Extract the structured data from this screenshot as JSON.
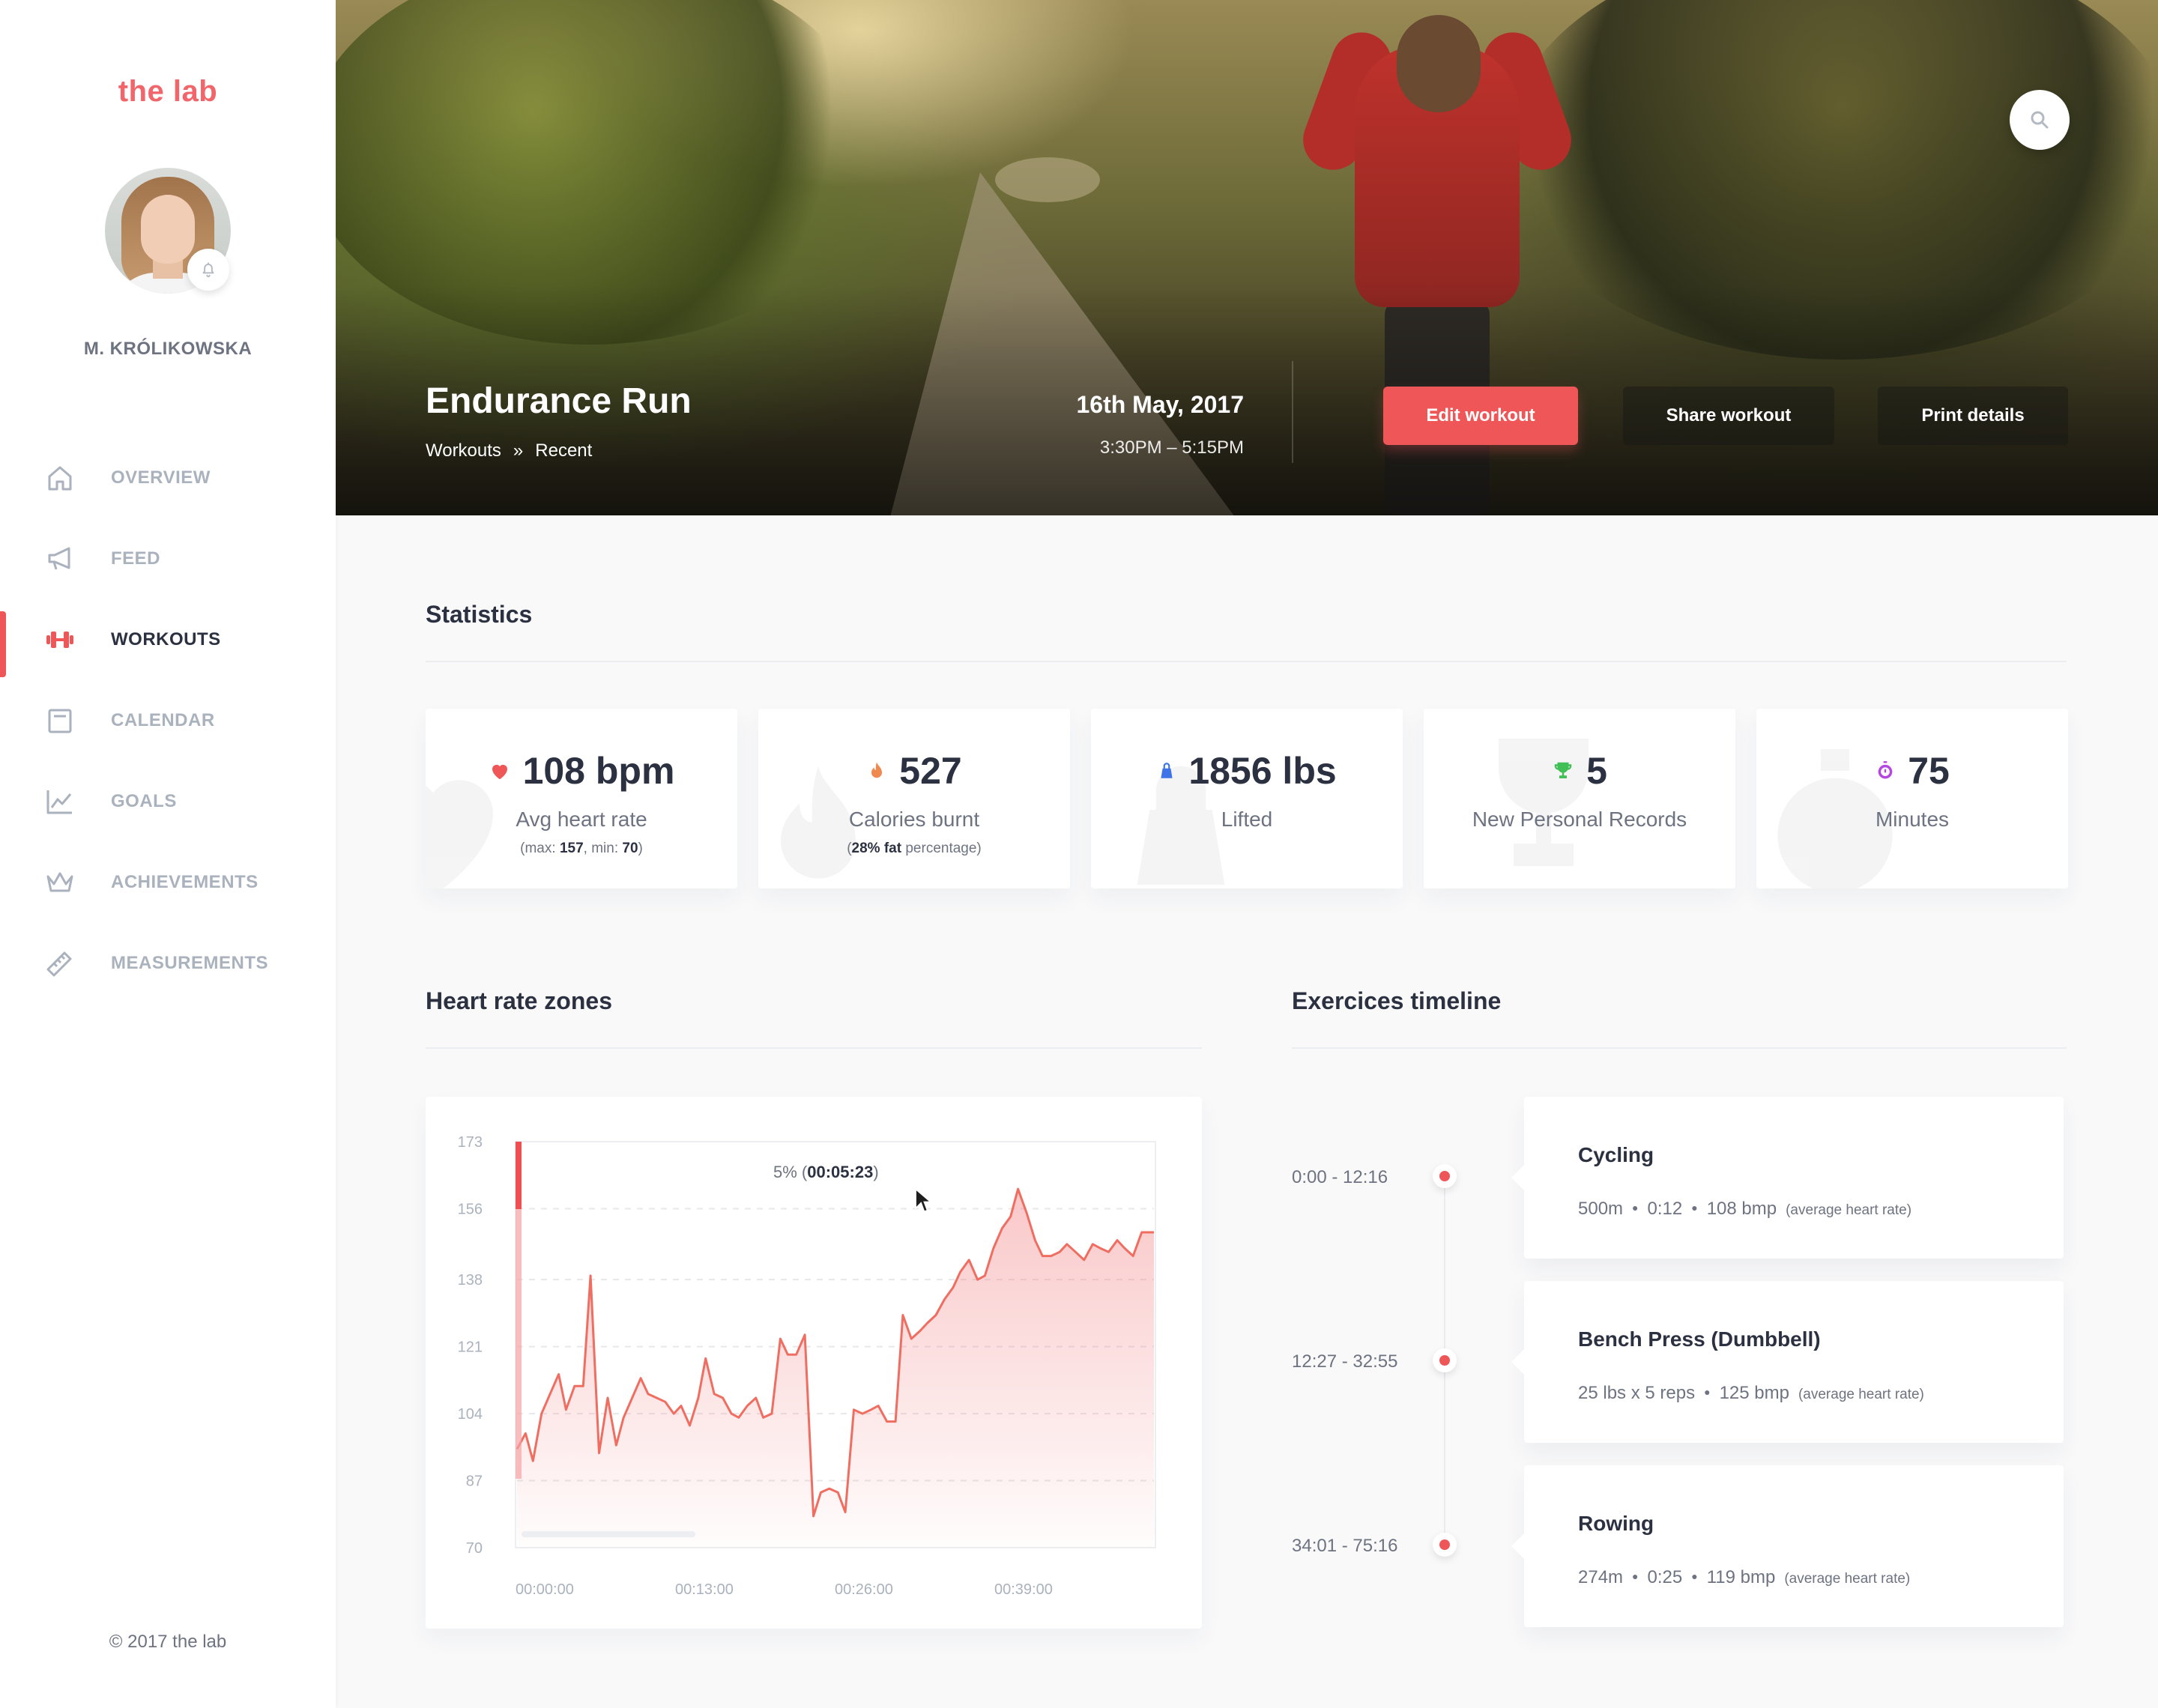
{
  "sidebar": {
    "logo": "the lab",
    "user_name": "M. KRÓLIKOWSKA",
    "nav": [
      {
        "label": "OVERVIEW",
        "icon": "home-icon",
        "active": false
      },
      {
        "label": "FEED",
        "icon": "megaphone-icon",
        "active": false
      },
      {
        "label": "WORKOUTS",
        "icon": "dumbbell-icon",
        "active": true
      },
      {
        "label": "CALENDAR",
        "icon": "calendar-icon",
        "active": false
      },
      {
        "label": "GOALS",
        "icon": "chart-line-icon",
        "active": false
      },
      {
        "label": "ACHIEVEMENTS",
        "icon": "crown-icon",
        "active": false
      },
      {
        "label": "MEASUREMENTS",
        "icon": "ruler-icon",
        "active": false
      }
    ],
    "copyright": "© 2017 the lab"
  },
  "hero": {
    "title": "Endurance Run",
    "breadcrumb": [
      "Workouts",
      "»",
      "Recent"
    ],
    "date": "16th May, 2017",
    "time": "3:30PM – 5:15PM",
    "buttons": {
      "edit": "Edit workout",
      "share": "Share workout",
      "print": "Print details"
    }
  },
  "statistics": {
    "title": "Statistics",
    "cards": [
      {
        "icon": "heart-icon",
        "icon_color": "#ef5658",
        "value": "108 bpm",
        "label": "Avg heart rate",
        "sub": {
          "pre": "(max: ",
          "b1": "157",
          "mid": ", min: ",
          "b2": "70",
          "post": ")"
        }
      },
      {
        "icon": "flame-icon",
        "icon_color": "#f0894f",
        "value": "527",
        "label": "Calories burnt",
        "sub": {
          "pre": "(",
          "b1": "28% fat",
          "mid": " percentage)",
          "b2": "",
          "post": ""
        }
      },
      {
        "icon": "kettlebell-icon",
        "icon_color": "#3f74e8",
        "value": "1856 lbs",
        "label": "Lifted"
      },
      {
        "icon": "trophy-icon",
        "icon_color": "#3fbf55",
        "value": "5",
        "label": "New Personal Records"
      },
      {
        "icon": "stopwatch-icon",
        "icon_color": "#b548e0",
        "value": "75",
        "label": "Minutes"
      }
    ]
  },
  "heart_rate": {
    "title": "Heart rate zones",
    "tooltip": {
      "prefix": "5% (",
      "value": "00:05:23",
      "suffix": ")"
    }
  },
  "chart_data": {
    "type": "area",
    "title": "Heart rate zones",
    "y_ticks": [
      173,
      156,
      138,
      121,
      104,
      87,
      70
    ],
    "ylim": [
      70,
      173
    ],
    "x_ticks": [
      "00:00:00",
      "00:13:00",
      "00:26:00",
      "00:39:00"
    ],
    "x_range_minutes": [
      0,
      52
    ],
    "series": [
      {
        "x": [
          0,
          0.7,
          1.3,
          2.0,
          2.7,
          3.4,
          4.0,
          4.7,
          5.4,
          6.0,
          6.7,
          7.4,
          8.1,
          8.7,
          9.4,
          10.1,
          10.7,
          11.4,
          12.1,
          12.8,
          13.4,
          14.1,
          14.8,
          15.4,
          16.1,
          16.8,
          17.5,
          18.1,
          18.8,
          19.5,
          20.1,
          20.8,
          21.5,
          22.1,
          22.8,
          23.5,
          24.2,
          24.8,
          25.5,
          26.2,
          26.8,
          27.5,
          28.2,
          28.9,
          29.5,
          30.2,
          30.9,
          31.5,
          32.2,
          32.9,
          33.5,
          34.2,
          34.9,
          35.6,
          36.2,
          36.9,
          37.6,
          38.2,
          38.9,
          39.6,
          40.3,
          40.9,
          41.6,
          42.3,
          42.9,
          43.6,
          44.3,
          44.9,
          45.6,
          46.3,
          47.0,
          47.6,
          48.3,
          49.0,
          49.6,
          50.3,
          51.0,
          51.6,
          52.0
        ],
        "y": [
          95,
          99,
          92,
          104,
          109,
          114,
          105,
          111,
          111,
          139,
          94,
          108,
          96,
          103,
          108,
          113,
          109,
          108,
          107,
          104,
          106,
          101,
          108,
          118,
          109,
          108,
          104,
          103,
          106,
          108,
          103,
          104,
          123,
          119,
          119,
          124,
          78,
          84,
          85,
          84,
          79,
          105,
          104,
          105,
          106,
          102,
          102,
          129,
          123,
          125,
          127,
          129,
          133,
          136,
          140,
          143,
          138,
          139,
          146,
          151,
          154,
          161,
          155,
          148,
          144,
          144,
          145,
          147,
          145,
          143,
          147,
          146,
          145,
          148,
          146,
          144,
          150,
          150,
          150
        ]
      }
    ],
    "grid": true,
    "legend": "none"
  },
  "timeline": {
    "title": "Exercices timeline",
    "items": [
      {
        "time": "0:00 - 12:16",
        "name": "Cycling",
        "stats": [
          "500m",
          "0:12",
          "108 bmp"
        ],
        "note": "(average heart rate)"
      },
      {
        "time": "12:27 - 32:55",
        "name": "Bench Press (Dumbbell)",
        "stats": [
          "25 lbs x 5 reps",
          "125 bmp"
        ],
        "note": "(average heart rate)"
      },
      {
        "time": "34:01 - 75:16",
        "name": "Rowing",
        "stats": [
          "274m",
          "0:25",
          "119 bmp"
        ],
        "note": "(average heart rate)"
      }
    ]
  }
}
